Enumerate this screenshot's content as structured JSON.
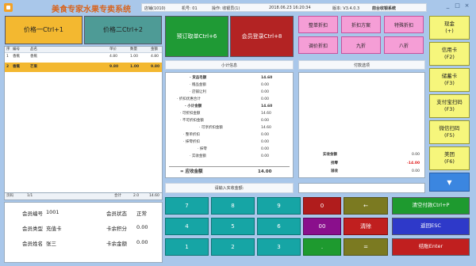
{
  "app": {
    "title": "美食专家水果专卖系统"
  },
  "info_bar": {
    "store": "店铺(1010)",
    "machine": "机号: 01",
    "operator": "操作: 收银员(1)",
    "datetime": "2018.06.23 16:20:34",
    "version": "版本: V3.4.0.3",
    "mode": "前台收银系统"
  },
  "price_buttons": {
    "price1": "价格一Ctrl+1",
    "price2": "价格二Ctrl+2"
  },
  "items_table": {
    "headers": [
      "序",
      "编号",
      "品名",
      "单价",
      "数量",
      "金额"
    ],
    "rows": [
      {
        "no": "1",
        "code": "香蕉",
        "name": "香蕉",
        "price": "4.80",
        "qty": "1.00",
        "amount": "4.80"
      },
      {
        "no": "2",
        "code": "香蕉",
        "name": "芒果",
        "price": "9.80",
        "qty": "1.00",
        "amount": "9.80"
      }
    ],
    "footer": {
      "page_label": "页码",
      "page": "1/1",
      "total_label": "合计",
      "total_qty": "2.0",
      "total_amount": "14.60"
    }
  },
  "member": {
    "code_label": "会员编号",
    "code": "1001",
    "status_label": "会员状态",
    "status": "正常",
    "type_label": "会员类型",
    "type": "充值卡",
    "points_label": "卡余积分",
    "points": "0.00",
    "name_label": "会员姓名",
    "name": "张三",
    "balance_label": "卡余金额",
    "balance": "0.00"
  },
  "action_buttons": {
    "prepay": "预订取单Ctrl+6",
    "member_login": "会员登录Ctrl+8"
  },
  "subtotal_section": {
    "header": "小计信息",
    "lines": [
      {
        "label": "· 货品毛额",
        "value": "14.60",
        "bold": true
      },
      {
        "label": "· 赠品金额",
        "value": "0.00"
      },
      {
        "label": "· 店铺让利",
        "value": "0.00"
      },
      {
        "label": "· 折扣优惠合计",
        "value": "0.00"
      },
      {
        "label": "· 小计金额",
        "value": "14.60",
        "bold": true
      },
      {
        "label": "· 可折扣金额",
        "value": "14.60"
      },
      {
        "label": "· 不可折扣金额",
        "value": "0.00"
      },
      {
        "label": "· 可享折扣金额",
        "value": "14.60"
      },
      {
        "label": "· 整单折扣",
        "value": "0.00"
      },
      {
        "label": "· 抹零折扣",
        "value": "0.00"
      },
      {
        "label": "· 抹零",
        "value": "0.00"
      },
      {
        "label": "· 实收金额",
        "value": "0.00"
      }
    ],
    "due_label": "= 应收金额",
    "due_value": "14.00",
    "input_hint": "请输入实收金额:"
  },
  "discount_buttons": [
    "整单折扣",
    "折扣方案",
    "特殊折扣",
    "调价折扣",
    "九折",
    "八折"
  ],
  "payment_section": {
    "header": "付款选项",
    "received_label": "实收金额",
    "received": "0.00",
    "diff_label": "找零",
    "diff": "-14.00",
    "change_label": "溢收",
    "change": "0.00"
  },
  "keypad": {
    "keys": [
      "7",
      "8",
      "9",
      "0",
      "←",
      "4",
      "5",
      "6",
      "00",
      "清除",
      "1",
      "2",
      "3",
      ".",
      "="
    ]
  },
  "right_actions": {
    "clear": "清空付款Ctrl+P",
    "back": "返回ESC",
    "settle": "结账Enter"
  },
  "pay_methods": [
    {
      "name": "现金",
      "key": "(+)"
    },
    {
      "name": "信用卡",
      "key": "(F2)"
    },
    {
      "name": "储蓄卡",
      "key": "(F3)"
    },
    {
      "name": "支付宝扫码",
      "key": "(F3)"
    },
    {
      "name": "微信扫码",
      "key": "(F5)"
    },
    {
      "name": "美团",
      "key": "(F6)"
    }
  ],
  "scroll_down_icon": "▼",
  "colors": {
    "price_btn": "#f3b830",
    "price2_btn": "#4e9b96",
    "prepay_btn": "#1f9a35",
    "member_btn": "#b32323",
    "pink": "#f59ed6",
    "yellow": "#f6f67c",
    "teal": "#16a5a5",
    "red_key": "#b01c1c",
    "olive_key": "#7b7a21",
    "purple_key": "#8a0f8c",
    "green_action": "#1e9a2f",
    "blue_action": "#2e39c9",
    "red_action": "#c01f1f"
  }
}
